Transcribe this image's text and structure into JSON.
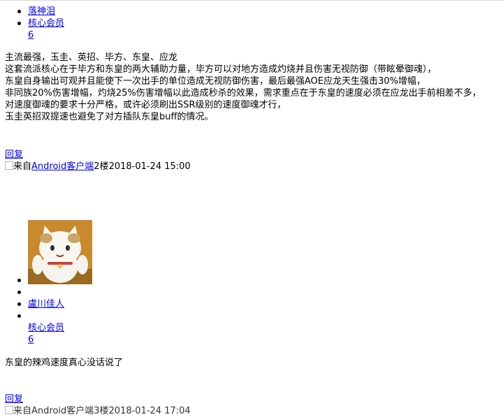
{
  "post1": {
    "user_name": "落神泪",
    "member_title": "核心会员",
    "level": "6",
    "content_lines": [
      "主流最强，玉圭、英招、毕方、东皇、应龙",
      "这套流派核心在于毕方和东皇的两大辅助力量，毕方可以对地方造成灼烧并且伤害无视防御（带眩晕御魂），",
      "东皇自身输出可观并且能使下一次出手的单位造成无视防御伤害，最后最强AOE应龙天生强击30%增幅，",
      "非同族20%伤害增幅，灼烧25%伤害增幅以此造成秒杀的效果，需求重点在于东皇的速度必须在应龙出手前相差不多，",
      "对速度御魂的要求十分严格，或许必须刷出SSR级别的速度御魂才行，",
      "玉圭英招双提速也避免了对方插队东皇buff的情况。"
    ],
    "reply_label": "回复",
    "source_prefix": "来自",
    "source_link": "Android客户端",
    "floor": "2楼",
    "timestamp": "2018-01-24 15:00"
  },
  "post2": {
    "user_name": "盧川佳人",
    "member_title": "核心会员",
    "level": "6",
    "content": "东皇的辣鸡速度真心没话说了",
    "reply_label": "回复",
    "source_partial": "来自Android客户端3楼2018-01-24 17:04"
  },
  "colors": {
    "link": "#0000ee",
    "avatar_bg": "#c88a2c"
  },
  "icons": {
    "avatar": "cat-avatar-icon",
    "broken_image": "broken-image-icon"
  }
}
